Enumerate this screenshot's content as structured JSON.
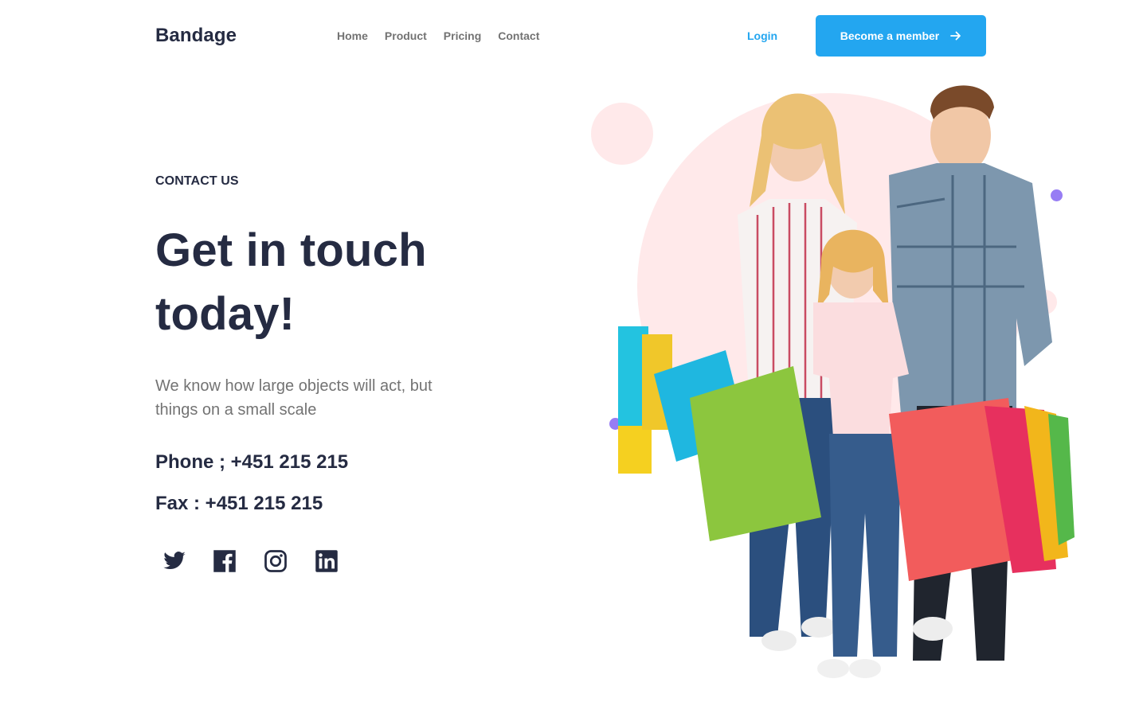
{
  "header": {
    "brand": "Bandage",
    "nav": [
      "Home",
      "Product",
      "Pricing",
      "Contact"
    ],
    "login_label": "Login",
    "cta_label": "Become a member"
  },
  "contact": {
    "eyebrow": "CONTACT US",
    "headline": "Get in touch today!",
    "description": "We know how large objects will act, but things on a small scale",
    "phone": "Phone ; +451 215 215",
    "fax": "Fax : +451 215 215"
  },
  "socials": [
    "twitter-icon",
    "facebook-icon",
    "instagram-icon",
    "linkedin-icon"
  ],
  "colors": {
    "primary": "#23A6F0",
    "heading": "#252B42",
    "muted": "#737373",
    "pink": "#FFE9EA",
    "purple": "#977DF4"
  }
}
